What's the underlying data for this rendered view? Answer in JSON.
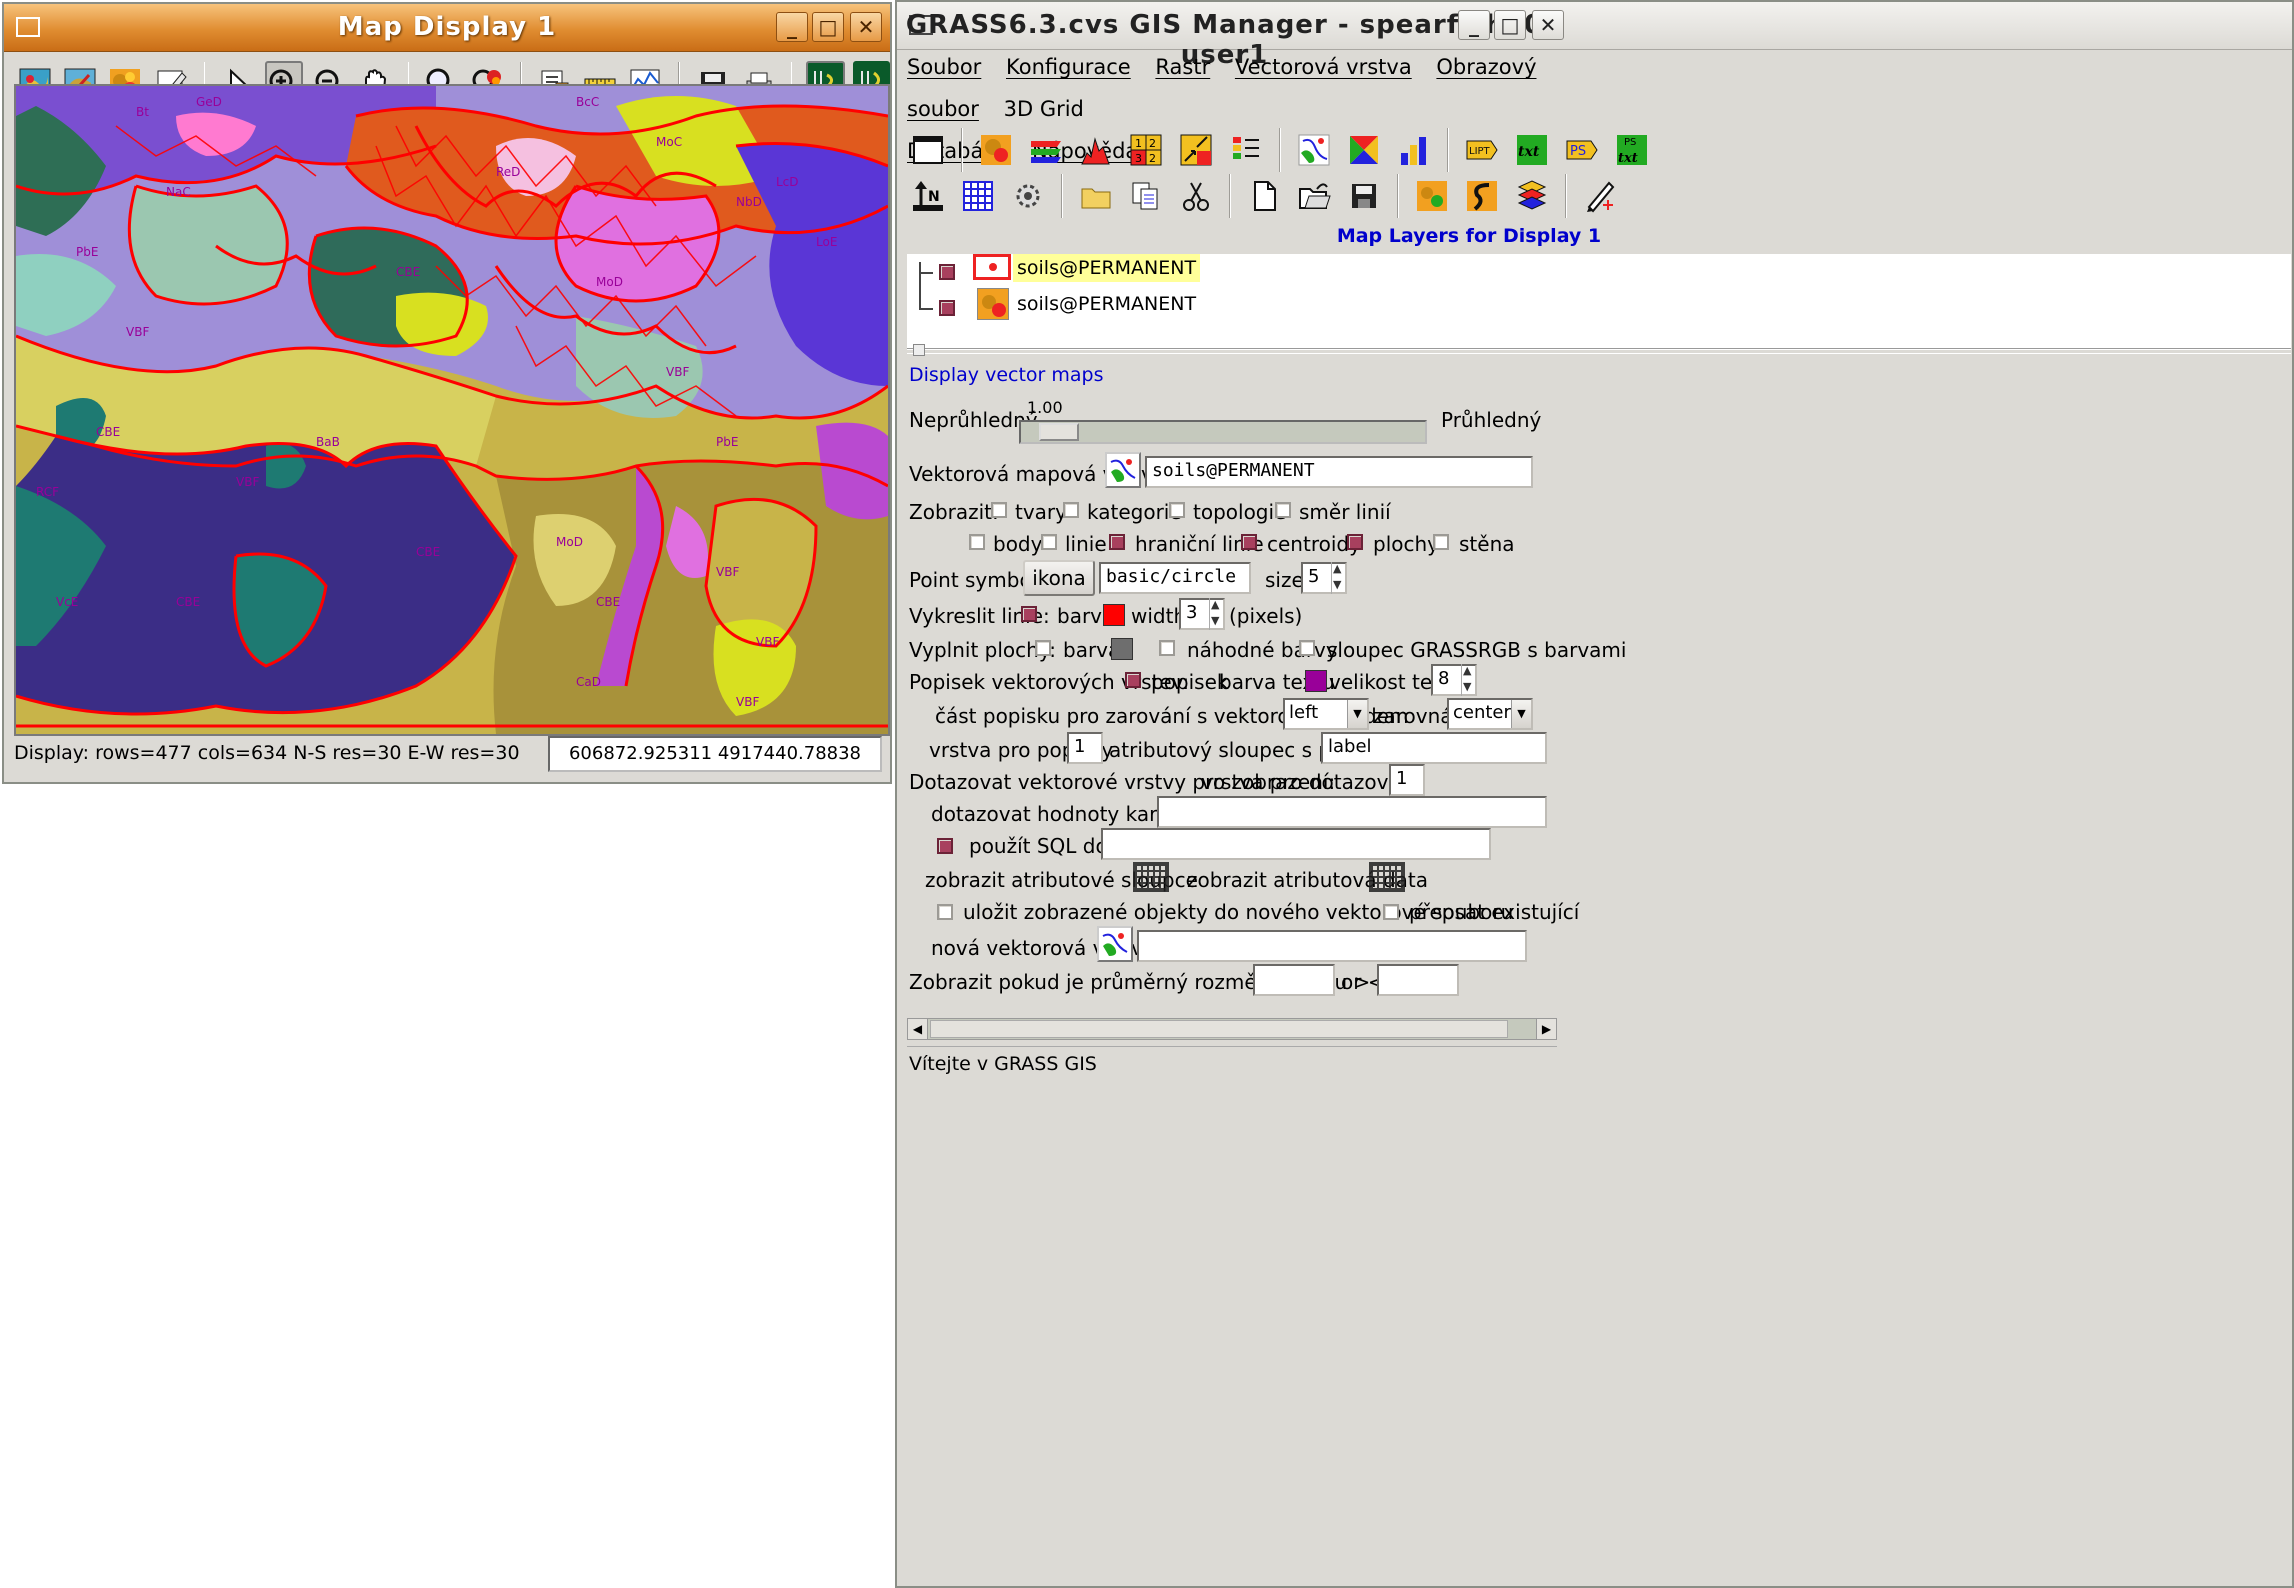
{
  "map_window": {
    "title": "Map Display 1",
    "status": "Display: rows=477 cols=634 N-S res=30 E-W res=30",
    "coords": "606872.925311 4917440.78838"
  },
  "map_labels": [
    "NaC",
    "PbE",
    "VBF",
    "CBE",
    "RCF",
    "VcE",
    "MoD",
    "LoE",
    "BcC",
    "Bt",
    "ReD",
    "MoC",
    "GeD",
    "CBE",
    "VBF",
    "PbE",
    "NbD",
    "LcD",
    "BaB",
    "VBF",
    "CBE",
    "CBE",
    "VBF",
    "VBF",
    "MoD",
    "CaD",
    "VBF",
    "CBE"
  ],
  "manager": {
    "title": "GRASS6.3.cvs GIS Manager - spearfish60 user1",
    "menu": [
      "Soubor",
      "Konfigurace",
      "Rastr",
      "Vectorová vrstva",
      "Obrazový soubor",
      "3D Grid",
      "Databáze",
      "Nápověda"
    ],
    "layers_header": "Map Layers for Display 1",
    "layers": [
      "soils@PERMANENT",
      "soils@PERMANENT"
    ],
    "section_title": "Display vector maps",
    "opacity": {
      "left": "Neprůhledný",
      "right": "Průhledný",
      "value": "1.00",
      "fraction": 0.05
    },
    "vector_label": "Vektorová mapová vrstva:",
    "vector_value": "soils@PERMANENT",
    "show_label": "Zobrazit:",
    "show_row1": [
      "tvary",
      "kategorie",
      "topologie",
      "směr linií"
    ],
    "show_row2": [
      "body",
      "linie",
      "hraniční linie",
      "centroidy",
      "plochy",
      "stěna"
    ],
    "point_label": "Point symbols:",
    "icon_button": "ikona",
    "point_symbol": "basic/circle",
    "size_label": "size",
    "size_value": "5",
    "lines_label": "Vykreslit linie:",
    "color_label": "barva",
    "width_label": "width",
    "width_value": "3",
    "pixels_label": "(pixels)",
    "fill_label": "Vyplnit plochy:",
    "fill_color_label": "barva",
    "random_colors": "náhodné barvy",
    "grassrgb": "sloupec GRASSRGB s barvami",
    "labels_label": "Popisek vektorových vrstev:",
    "label_cb": "popisek",
    "text_color_label": "barva textu",
    "text_size_label": "velikost textu",
    "text_size_value": "8",
    "align_part_label": "část popisku pro zarování s vektorovým bodem",
    "align_part_value": "left",
    "align_label": "zarovnání",
    "align_value": "center",
    "label_layer_label": "vrstva pro popisky",
    "label_layer_value": "1",
    "label_col_label": "atributový sloupec s popisky",
    "label_col_value": "label",
    "query_label": "Dotazovat vektorové vrstvy pro zobrazení:",
    "query_layer_label": "vrstva pro dotazování",
    "query_layer_value": "1",
    "query_cats_label": "dotazovat hodnoty karegorií",
    "sql_label": "použít SQL dotaz",
    "attr_cols_label": "zobrazit atributové sloupce",
    "attr_data_label": "zobrazit atributová data",
    "save_label": "uložit zobrazené objekty do nového vektorové souboru",
    "overwrite_label": "přepsat existující",
    "new_layer_label": "nová vektorová vrstva",
    "region_label": "Zobrazit pokud je průměrný rozměr regionu >",
    "or_label": "or <",
    "statusbar": "Vítejte v GRASS GIS"
  },
  "colors": {
    "line": "#ff0000",
    "text": "#990099",
    "fill": "#6e6e6e",
    "accent": "#0000cc"
  }
}
